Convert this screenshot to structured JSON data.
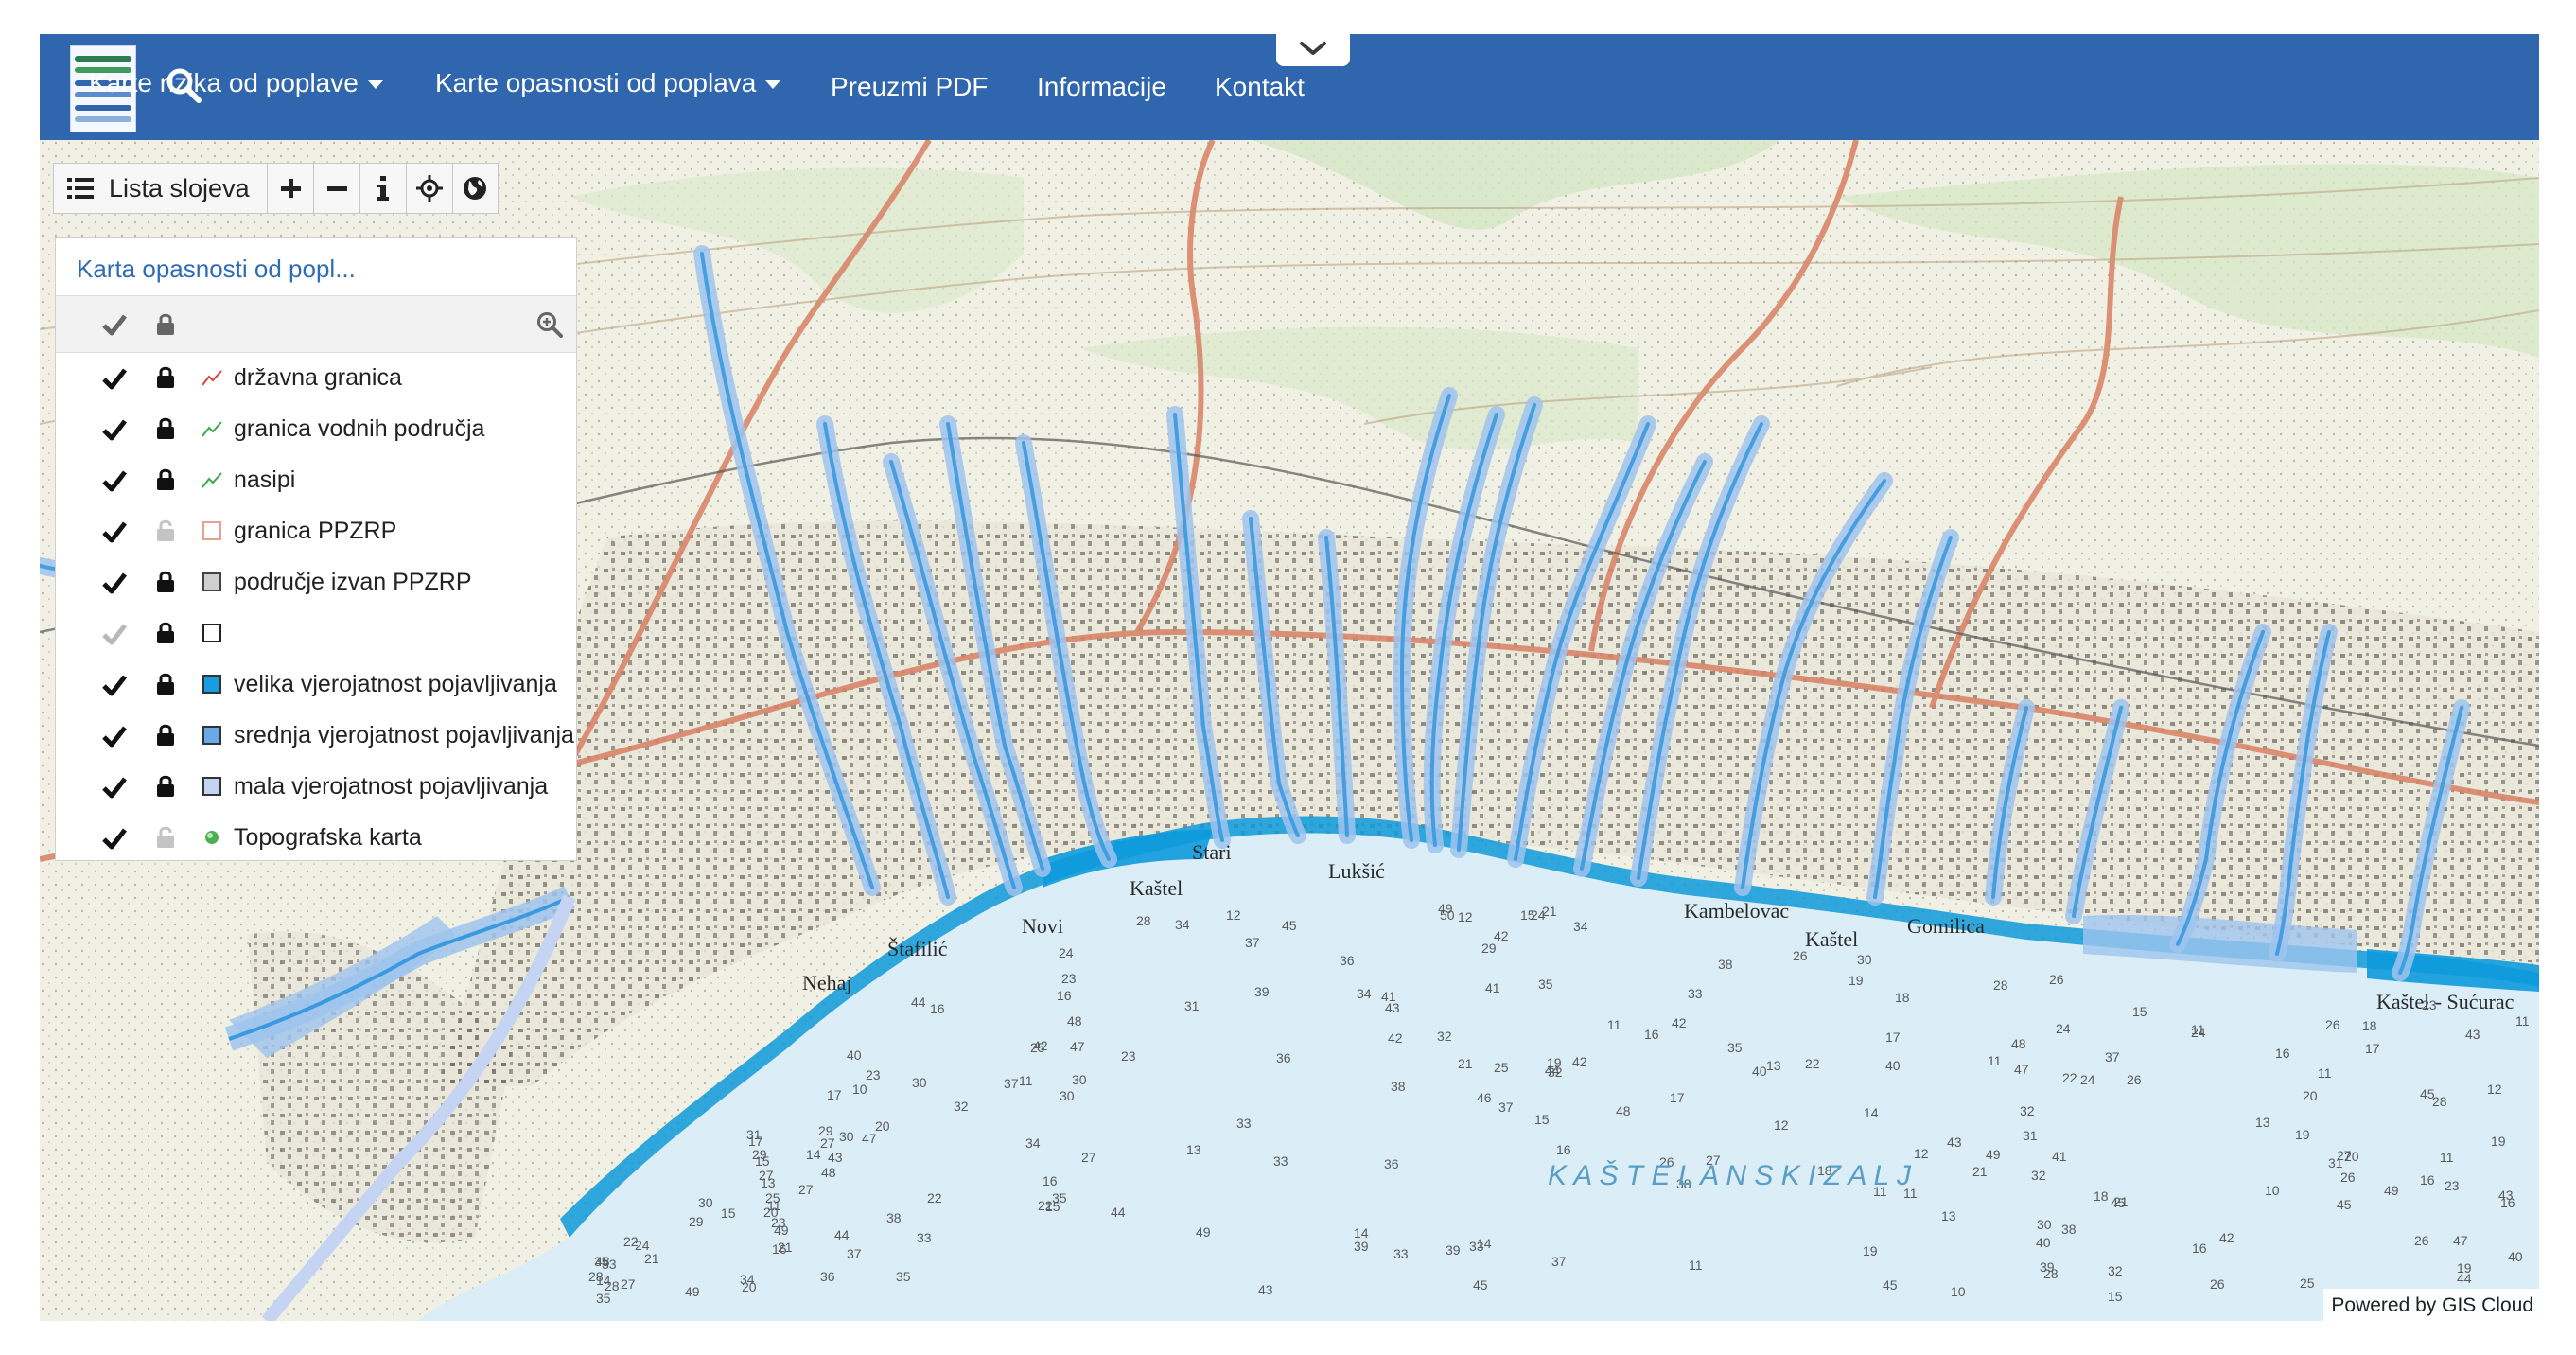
{
  "navbar": {
    "items": [
      {
        "label": "Karte rizika od poplave",
        "dropdown": true
      },
      {
        "label": "Karte opasnosti od poplava",
        "dropdown": true
      },
      {
        "label": "Preuzmi PDF",
        "dropdown": false
      },
      {
        "label": "Informacije",
        "dropdown": false
      },
      {
        "label": "Kontakt",
        "dropdown": false
      }
    ],
    "background": "#2f66ae"
  },
  "toolbar": {
    "layer_list_label": "Lista slojeva",
    "tools": [
      "plus-icon",
      "minus-icon",
      "info-icon",
      "crosshair-icon",
      "globe-icon"
    ]
  },
  "layer_panel": {
    "title": "Karta opasnosti od popl...",
    "layers": [
      {
        "label": "državna granica",
        "visible": true,
        "locked": true,
        "symbol": "line",
        "color": "#e0403a"
      },
      {
        "label": "granica vodnih područja",
        "visible": true,
        "locked": true,
        "symbol": "line",
        "color": "#3daa4a"
      },
      {
        "label": "nasipi",
        "visible": true,
        "locked": true,
        "symbol": "line",
        "color": "#3daa4a"
      },
      {
        "label": "granica PPZRP",
        "visible": true,
        "locked": false,
        "symbol": "square",
        "color": "#ffffff",
        "border": "#e8a090"
      },
      {
        "label": "područje izvan PPZRP",
        "visible": true,
        "locked": true,
        "symbol": "square",
        "color": "#cfcfcf",
        "border": "#444444"
      },
      {
        "label": "",
        "visible": false,
        "locked": true,
        "symbol": "square",
        "color": "#ffffff",
        "border": "#222222"
      },
      {
        "label": "velika vjerojatnost pojavljivanja",
        "visible": true,
        "locked": true,
        "symbol": "square",
        "color": "#1a9de0",
        "border": "#333333"
      },
      {
        "label": "srednja vjerojatnost pojavljivanja",
        "visible": true,
        "locked": true,
        "symbol": "square",
        "color": "#6aa8e8",
        "border": "#333333"
      },
      {
        "label": "mala vjerojatnost pojavljivanja",
        "visible": true,
        "locked": true,
        "symbol": "square",
        "color": "#c4d4f2",
        "border": "#333333"
      },
      {
        "label": "Topografska karta",
        "visible": true,
        "locked": false,
        "symbol": "globe",
        "color": "#4caf50"
      }
    ]
  },
  "map": {
    "places": [
      {
        "name": "Stari"
      },
      {
        "name": "Lukšić"
      },
      {
        "name": "Kaštel"
      },
      {
        "name": "Novi"
      },
      {
        "name": "Štafilić"
      },
      {
        "name": "Nehaj"
      },
      {
        "name": "Kambelovac"
      },
      {
        "name": "Kaštel"
      },
      {
        "name": "Gomilica"
      },
      {
        "name": "Kaštel - Sućurac"
      }
    ],
    "sea_name": "K A Š T E L A N S K I   Z A L J"
  },
  "attribution": "Powered by GIS Cloud"
}
